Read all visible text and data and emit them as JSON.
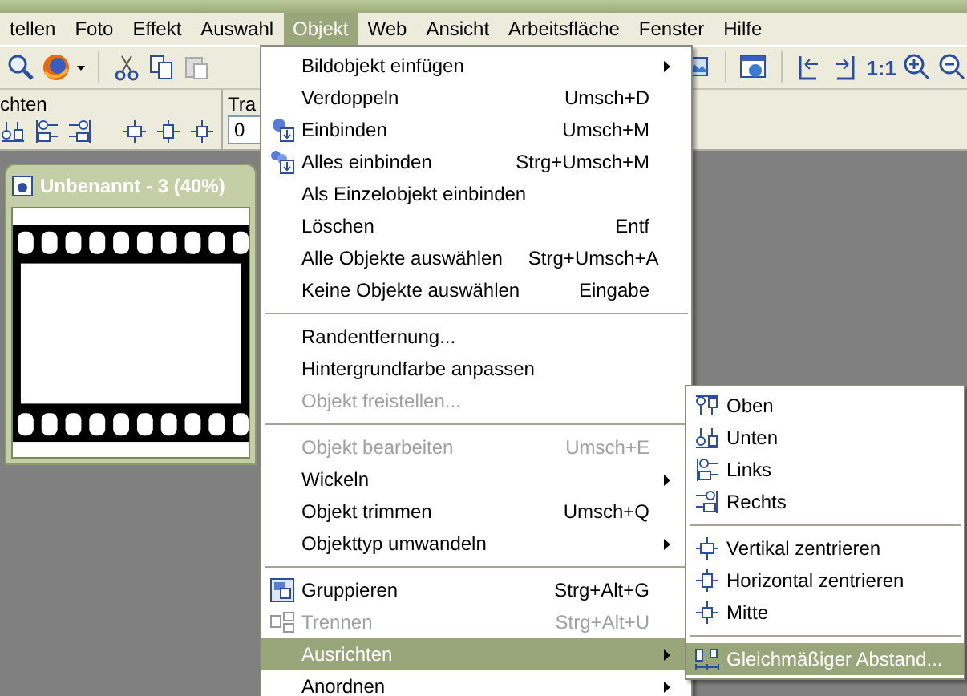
{
  "menubar": [
    {
      "label": "tellen",
      "selected": false
    },
    {
      "label": "Foto",
      "selected": false
    },
    {
      "label": "Effekt",
      "selected": false
    },
    {
      "label": "Auswahl",
      "selected": false
    },
    {
      "label": "Objekt",
      "selected": true
    },
    {
      "label": "Web",
      "selected": false
    },
    {
      "label": "Ansicht",
      "selected": false
    },
    {
      "label": "Arbeitsfläche",
      "selected": false
    },
    {
      "label": "Fenster",
      "selected": false
    },
    {
      "label": "Hilfe",
      "selected": false
    }
  ],
  "toolbar": {
    "zoom_label": "1:1"
  },
  "attribute_bar": {
    "section_label": "chten",
    "field_label": "Tra",
    "field_value": "0"
  },
  "document": {
    "title": "Unbenannt - 3 (40%)"
  },
  "object_menu": [
    {
      "kind": "item",
      "label": "Bildobjekt einfügen",
      "submenu": true,
      "disabled": false,
      "selected": false
    },
    {
      "kind": "item",
      "label": "Verdoppeln",
      "shortcut": "Umsch+D",
      "submenu": false,
      "disabled": false,
      "selected": false
    },
    {
      "kind": "icon",
      "label": "Einbinden",
      "shortcut": "Umsch+M",
      "submenu": false,
      "disabled": false,
      "selected": false
    },
    {
      "kind": "icon",
      "label": "Alles einbinden",
      "shortcut": "Strg+Umsch+M",
      "submenu": false,
      "disabled": false,
      "selected": false
    },
    {
      "kind": "item",
      "label": "Als Einzelobjekt einbinden",
      "submenu": false,
      "disabled": false,
      "selected": false
    },
    {
      "kind": "item",
      "label": "Löschen",
      "shortcut": "Entf",
      "submenu": false,
      "disabled": false,
      "selected": false
    },
    {
      "kind": "item",
      "label": "Alle Objekte auswählen",
      "shortcut": "Strg+Umsch+A",
      "submenu": false,
      "disabled": false,
      "selected": false
    },
    {
      "kind": "item",
      "label": "Keine Objekte auswählen",
      "shortcut": "Eingabe",
      "submenu": false,
      "disabled": false,
      "selected": false
    },
    {
      "kind": "separator"
    },
    {
      "kind": "item",
      "label": "Randentfernung...",
      "submenu": false,
      "disabled": false,
      "selected": false
    },
    {
      "kind": "item",
      "label": "Hintergrundfarbe anpassen",
      "submenu": false,
      "disabled": false,
      "selected": false
    },
    {
      "kind": "item",
      "label": "Objekt freistellen...",
      "submenu": false,
      "disabled": true,
      "selected": false
    },
    {
      "kind": "separator"
    },
    {
      "kind": "item",
      "label": "Objekt bearbeiten",
      "shortcut": "Umsch+E",
      "submenu": false,
      "disabled": true,
      "selected": false
    },
    {
      "kind": "item",
      "label": "Wickeln",
      "submenu": true,
      "disabled": false,
      "selected": false
    },
    {
      "kind": "item",
      "label": "Objekt trimmen",
      "shortcut": "Umsch+Q",
      "submenu": false,
      "disabled": false,
      "selected": false
    },
    {
      "kind": "item",
      "label": "Objekttyp umwandeln",
      "submenu": true,
      "disabled": false,
      "selected": false
    },
    {
      "kind": "separator"
    },
    {
      "kind": "icon",
      "label": "Gruppieren",
      "shortcut": "Strg+Alt+G",
      "submenu": false,
      "disabled": false,
      "selected": false
    },
    {
      "kind": "icon",
      "label": "Trennen",
      "shortcut": "Strg+Alt+U",
      "submenu": false,
      "disabled": true,
      "selected": false
    },
    {
      "kind": "item",
      "label": "Ausrichten",
      "submenu": true,
      "disabled": false,
      "selected": true
    },
    {
      "kind": "item",
      "label": "Anordnen",
      "submenu": true,
      "disabled": false,
      "selected": false
    }
  ],
  "align_submenu": [
    {
      "kind": "icon",
      "label": "Oben",
      "selected": false
    },
    {
      "kind": "icon",
      "label": "Unten",
      "selected": false
    },
    {
      "kind": "icon",
      "label": "Links",
      "selected": false
    },
    {
      "kind": "icon",
      "label": "Rechts",
      "selected": false
    },
    {
      "kind": "separator"
    },
    {
      "kind": "icon",
      "label": "Vertikal zentrieren",
      "selected": false
    },
    {
      "kind": "icon",
      "label": "Horizontal zentrieren",
      "selected": false
    },
    {
      "kind": "icon",
      "label": "Mitte",
      "selected": false
    },
    {
      "kind": "separator"
    },
    {
      "kind": "icon",
      "label": "Gleichmäßiger Abstand...",
      "selected": true
    }
  ]
}
